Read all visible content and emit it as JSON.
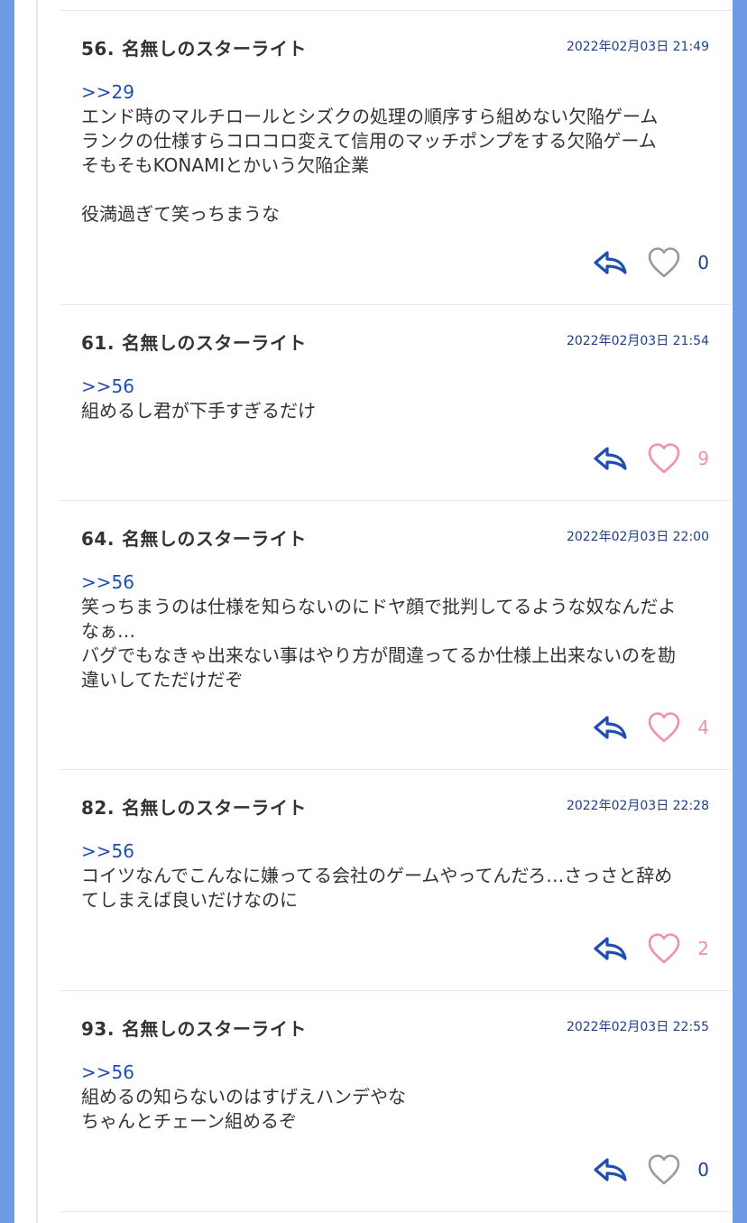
{
  "colors": {
    "accent": "#1f4eb0",
    "date": "#1f3f84",
    "liked": "#f08fb0",
    "unliked": "#999999",
    "page_bg": "#6f9be6"
  },
  "posts": [
    {
      "number": "56.",
      "name": "名無しのスターライト",
      "date": "2022年02月03日 21:49",
      "anchor": ">>29",
      "lines": [
        "エンド時のマルチロールとシズクの処理の順序すら組めない欠陥ゲーム",
        "ランクの仕様すらコロコロ変えて信用のマッチポンプをする欠陥ゲーム",
        "そもそもKONAMIとかいう欠陥企業",
        "",
        "役満過ぎて笑っちまうな"
      ],
      "likes": "0",
      "liked": false
    },
    {
      "number": "61.",
      "name": "名無しのスターライト",
      "date": "2022年02月03日 21:54",
      "anchor": ">>56",
      "lines": [
        "組めるし君が下手すぎるだけ"
      ],
      "likes": "9",
      "liked": true
    },
    {
      "number": "64.",
      "name": "名無しのスターライト",
      "date": "2022年02月03日 22:00",
      "anchor": ">>56",
      "lines": [
        "笑っちまうのは仕様を知らないのにドヤ顔で批判してるような奴なんだよ",
        "なぁ…",
        "バグでもなきゃ出来ない事はやり方が間違ってるか仕様上出来ないのを勘",
        "違いしてただけだぞ"
      ],
      "likes": "4",
      "liked": true
    },
    {
      "number": "82.",
      "name": "名無しのスターライト",
      "date": "2022年02月03日 22:28",
      "anchor": ">>56",
      "lines": [
        "コイツなんでこんなに嫌ってる会社のゲームやってんだろ…さっさと辞め",
        "てしまえば良いだけなのに"
      ],
      "likes": "2",
      "liked": true
    },
    {
      "number": "93.",
      "name": "名無しのスターライト",
      "date": "2022年02月03日 22:55",
      "anchor": ">>56",
      "lines": [
        "組めるの知らないのはすげえハンデやな",
        "ちゃんとチェーン組めるぞ"
      ],
      "likes": "0",
      "liked": false
    }
  ]
}
